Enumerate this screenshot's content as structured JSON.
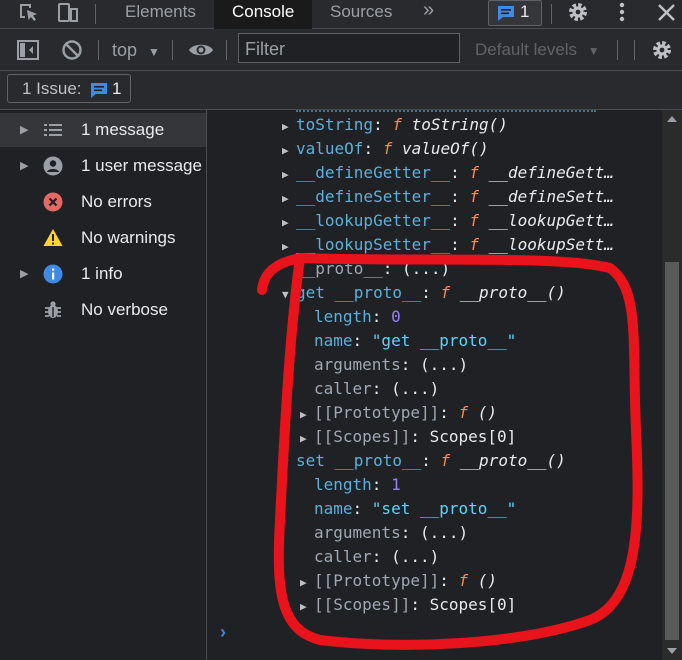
{
  "tabs": {
    "elements": "Elements",
    "console": "Console",
    "sources": "Sources",
    "more": "»",
    "badge_count": "1"
  },
  "toolbar": {
    "context": "top",
    "filter_placeholder": "Filter",
    "levels": "Default levels"
  },
  "issues": {
    "label": "1 Issue:",
    "count": "1"
  },
  "sidebar": {
    "items": [
      {
        "label": "1 message",
        "icon": "list-icon"
      },
      {
        "label": "1 user message",
        "icon": "user-icon"
      },
      {
        "label": "No errors",
        "icon": "error-icon"
      },
      {
        "label": "No warnings",
        "icon": "warning-icon"
      },
      {
        "label": "1 info",
        "icon": "info-icon"
      },
      {
        "label": "No verbose",
        "icon": "bug-icon"
      }
    ]
  },
  "console": {
    "lines": [
      {
        "key": "toString",
        "fn": "f",
        "name": "toString()"
      },
      {
        "key": "valueOf",
        "fn": "f",
        "name": "valueOf()"
      },
      {
        "key": "__defineGetter__",
        "fn": "f",
        "name": "__defineGett…"
      },
      {
        "key": "__defineSetter__",
        "fn": "f",
        "name": "__defineSett…"
      },
      {
        "key": "__lookupGetter__",
        "fn": "f",
        "name": "__lookupGett…"
      },
      {
        "key": "__lookupSetter__",
        "fn": "f",
        "name": "__lookupSett…"
      },
      {
        "key": "__proto__",
        "value": "(...)"
      },
      {
        "key": "get __proto__",
        "fn": "f",
        "name": "__proto__()"
      },
      {
        "key": "length",
        "value": "0"
      },
      {
        "key": "name",
        "value": "\"get __proto__\""
      },
      {
        "key": "arguments",
        "value": "(...)"
      },
      {
        "key": "caller",
        "value": "(...)"
      },
      {
        "key": "[[Prototype]]",
        "fn": "f",
        "name": "()"
      },
      {
        "key": "[[Scopes]]",
        "value": "Scopes[0]"
      },
      {
        "key": "set __proto__",
        "fn": "f",
        "name": "__proto__()"
      },
      {
        "key": "length",
        "value": "1"
      },
      {
        "key": "name",
        "value": "\"set __proto__\""
      },
      {
        "key": "arguments",
        "value": "(...)"
      },
      {
        "key": "caller",
        "value": "(...)"
      },
      {
        "key": "[[Prototype]]",
        "fn": "f",
        "name": "()"
      },
      {
        "key": "[[Scopes]]",
        "value": "Scopes[0]"
      }
    ],
    "prompt": "›"
  },
  "colors": {
    "accent": "#3f8ae2",
    "annotation": "#e8131b",
    "property": "#5db0d7",
    "function": "#f28b54",
    "number": "#9980ff",
    "string": "#5cd5fb"
  }
}
